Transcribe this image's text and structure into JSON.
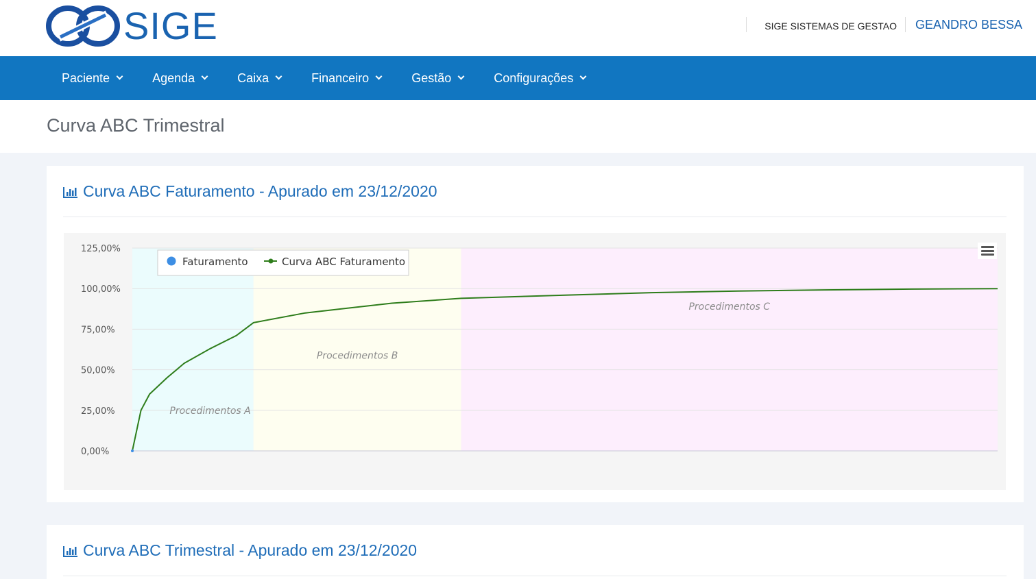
{
  "header": {
    "logo_text": "SIGE",
    "company": "SIGE SISTEMAS DE GESTAO",
    "user": "GEANDRO BESSA"
  },
  "nav": {
    "items": [
      {
        "label": "Paciente"
      },
      {
        "label": "Agenda"
      },
      {
        "label": "Caixa"
      },
      {
        "label": "Financeiro"
      },
      {
        "label": "Gestão"
      },
      {
        "label": "Configurações"
      }
    ]
  },
  "page": {
    "title": "Curva ABC Trimestral"
  },
  "cards": [
    {
      "title": "Curva ABC Faturamento - Apurado em 23/12/2020"
    },
    {
      "title": "Curva ABC Trimestral - Apurado em 23/12/2020"
    }
  ],
  "colors": {
    "brand": "#1176c1",
    "link": "#1f6db8",
    "curve": "#2e7d1b",
    "dot": "#3d8ee4",
    "band_a": "#ebfcfd",
    "band_b": "#fefef0",
    "band_c": "#fdeefd"
  },
  "chart_data": {
    "type": "line",
    "title": "",
    "ylim": [
      0,
      125
    ],
    "y_ticks": [
      "0,00%",
      "25,00%",
      "50,00%",
      "75,00%",
      "100,00%",
      "125,00%"
    ],
    "y_tick_values": [
      0,
      25,
      50,
      75,
      100,
      125
    ],
    "grid": true,
    "legend_position": "top-left",
    "legend": [
      {
        "name": "Faturamento",
        "marker": "dot"
      },
      {
        "name": "Curva ABC Faturamento",
        "marker": "line"
      }
    ],
    "bands": [
      {
        "label": "Procedimentos A",
        "from": 0,
        "to": 0.14,
        "color": "#ebfcfd"
      },
      {
        "label": "Procedimentos B",
        "from": 0.14,
        "to": 0.38,
        "color": "#fefef0"
      },
      {
        "label": "Procedimentos C",
        "from": 0.38,
        "to": 1.0,
        "color": "#fdeefd"
      }
    ],
    "series": [
      {
        "name": "Curva ABC Faturamento",
        "x": [
          0,
          0.01,
          0.02,
          0.04,
          0.06,
          0.09,
          0.12,
          0.14,
          0.2,
          0.3,
          0.38,
          0.5,
          0.6,
          0.7,
          0.8,
          0.9,
          1.0
        ],
        "values": [
          0,
          25,
          35,
          45,
          54,
          63,
          71,
          79,
          85,
          91,
          94,
          96,
          97.5,
          98.5,
          99.2,
          99.7,
          100
        ]
      }
    ]
  }
}
